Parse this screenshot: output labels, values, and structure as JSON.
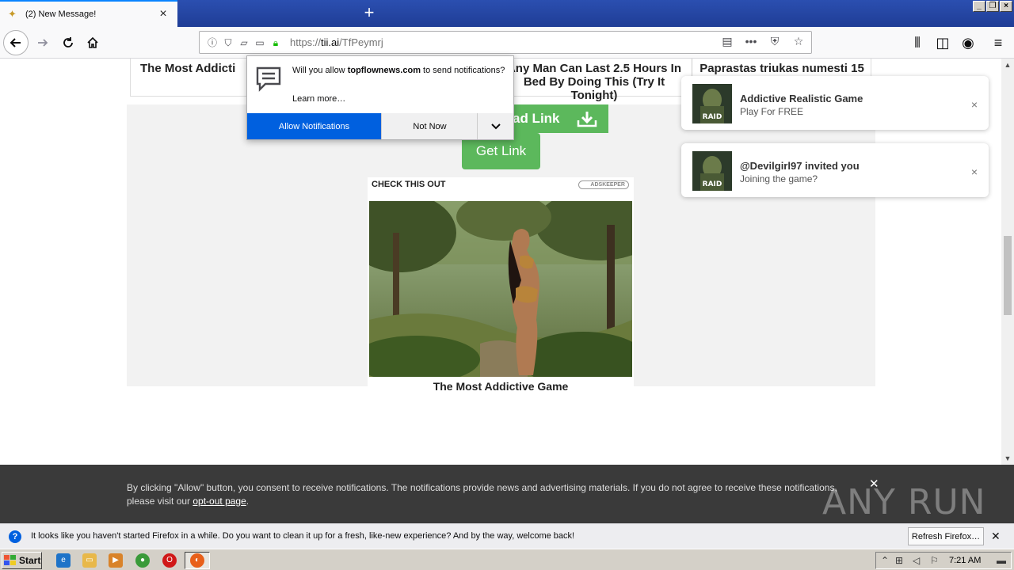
{
  "browser": {
    "tab_title": "(2) New Message!",
    "url_prefix": "https://",
    "url_host": "tii.ai",
    "url_path": "/TfPeymrj"
  },
  "page": {
    "cards": [
      "The Most Addicti",
      "Any Man Can Last 2.5 Hours In Bed By Doing This (Try It Tonight)",
      "Paprastas triukas numesti 15 kg per mėnesį. Išbandyk ši triuką"
    ],
    "download_label": "ad Link",
    "get_link_label": "Get Link",
    "ad": {
      "header": "CHECK THIS OUT",
      "network": "ADSKEEPER",
      "caption": "The Most Addictive Game"
    }
  },
  "toasts": [
    {
      "title": "Addictive Realistic Game",
      "body": "Play For FREE",
      "thumb_text": "RAID"
    },
    {
      "title": "@Devilgirl97 invited you",
      "body": "Joining the game?",
      "thumb_text": "RAID"
    }
  ],
  "permission": {
    "msg_prefix": "Will you allow ",
    "site": "topflownews.com",
    "msg_suffix": " to send notifications?",
    "learn_more": "Learn more…",
    "allow_label": "Allow Notifications",
    "not_now_label": "Not Now"
  },
  "consent": {
    "text": "By clicking \"Allow\" button, you consent to receive notifications. The notifications provide news and advertising materials. If you do not agree to receive these notifications, please visit our ",
    "link": "opt-out page",
    "end": "."
  },
  "watermark": "ANY RUN",
  "notification_bar": {
    "message": "It looks like you haven't started Firefox in a while. Do you want to clean it up for a fresh, like-new experience? And by the way, welcome back!",
    "button": "Refresh Firefox…"
  },
  "taskbar": {
    "start_label": "Start",
    "clock": "7:21 AM"
  },
  "colors": {
    "accent_blue": "#0060df",
    "green_button": "#5cb85c",
    "banner": "#3a3a3a"
  }
}
